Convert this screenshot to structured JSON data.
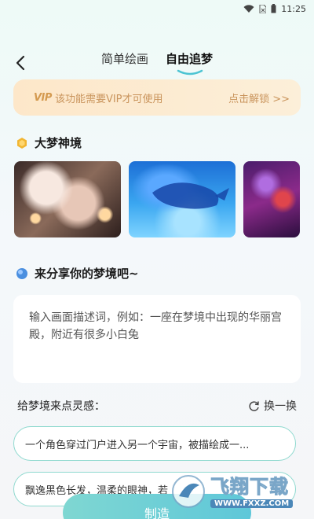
{
  "status_bar": {
    "time": "11:25"
  },
  "header": {
    "tabs": [
      {
        "label": "简单绘画",
        "active": false
      },
      {
        "label": "自由追梦",
        "active": true
      }
    ]
  },
  "vip_banner": {
    "logo": "VIP",
    "text": "该功能需要VIP才可使用",
    "unlock": "点击解锁 >>"
  },
  "gallery": {
    "title": "大梦神境",
    "items": [
      "dream-image-1",
      "dream-image-2",
      "dream-image-3"
    ]
  },
  "share": {
    "title": "来分享你的梦境吧~",
    "placeholder": "输入画面描述词，例如：一座在梦境中出现的华丽宫殿，附近有很多小白兔"
  },
  "inspiration": {
    "label": "给梦境来点灵感：",
    "refresh": "换一换",
    "suggestions": [
      "一个角色穿过门户进入另一个宇宙，被描绘成一...",
      "飘逸黑色长发，温柔的眼神，若"
    ]
  },
  "create_button": "制造",
  "watermark": {
    "title": "飞翔下载",
    "url": "WWW.FXXZ.COM"
  },
  "colors": {
    "accent": "#5ec7d9",
    "vip_text": "#c9945c",
    "suggestion_border": "#8fd9cf"
  }
}
